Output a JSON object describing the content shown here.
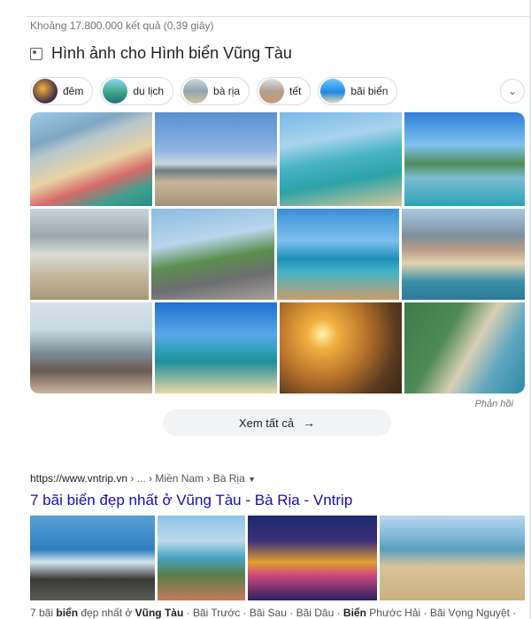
{
  "result_stats": "Khoảng 17.800.000 kết quả (0,39 giây)",
  "images_section": {
    "title": "Hình ảnh cho Hình biển Vũng Tàu",
    "chips": [
      {
        "label": "đêm"
      },
      {
        "label": "du lịch"
      },
      {
        "label": "bà rịa"
      },
      {
        "label": "tết"
      },
      {
        "label": "bãi biển"
      }
    ],
    "feedback": "Phản hồi",
    "see_all": "Xem tất cả"
  },
  "result": {
    "url_base": "https://www.vntrip.vn",
    "url_path": " › ... › Miền Nam › Bà Rịa",
    "title": "7 bãi biển đẹp nhất ở Vũng Tàu - Bà Rịa - Vntrip",
    "snippet_parts": [
      "7 bãi ",
      "biển",
      " đẹp nhất ở ",
      "Vũng Tàu",
      " · Bãi Trước · Bãi Sau · Bãi Dâu · ",
      "Biển",
      " Phước Hải · Bãi Vọng Nguyệt ·"
    ]
  },
  "colors": {
    "link": "#1a0dab",
    "text": "#202124",
    "muted": "#70757a"
  }
}
